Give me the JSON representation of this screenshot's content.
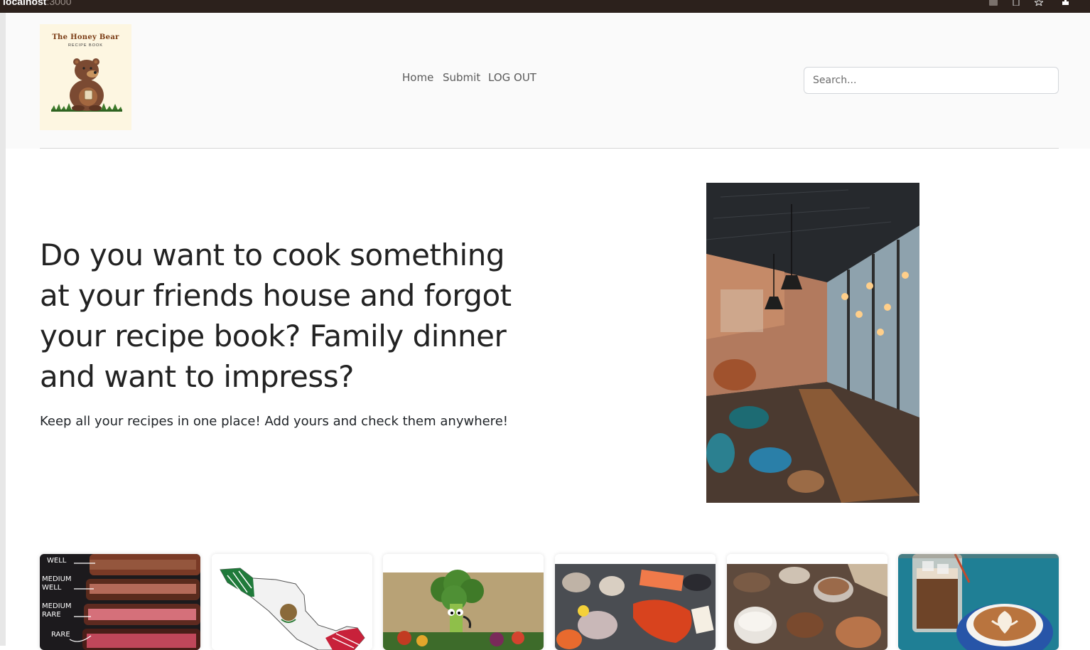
{
  "browser": {
    "url_host": "localhost",
    "url_port": ":3000"
  },
  "logo": {
    "title": "The Honey Bear",
    "subtitle": "RECIPE BOOK"
  },
  "nav": {
    "items": [
      {
        "label": "Home"
      },
      {
        "label": "Submit"
      },
      {
        "label": "LOG OUT"
      }
    ]
  },
  "search": {
    "placeholder": "Search..."
  },
  "hero": {
    "title": "Do you want to cook something at your friends house and forgot your recipe book? Family dinner and want to impress?",
    "subtitle": "Keep all your recipes in one place! Add yours and check them anywhere!"
  },
  "cards": {
    "steak_labels": [
      "WELL",
      "MEDIUM WELL",
      "MEDIUM RARE",
      "RARE"
    ],
    "items": [
      {
        "icon": "steak-doneness-image"
      },
      {
        "icon": "mexico-map-image"
      },
      {
        "icon": "broccoli-vegetables-image"
      },
      {
        "icon": "seafood-image"
      },
      {
        "icon": "sugar-spices-image"
      },
      {
        "icon": "coffee-image"
      }
    ]
  }
}
